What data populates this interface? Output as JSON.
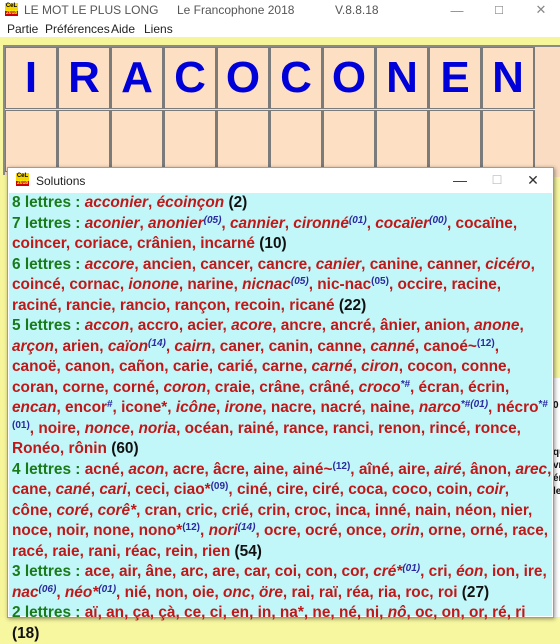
{
  "window": {
    "title": "LE MOT LE PLUS LONG",
    "subtitle": "Le Francophone 2018",
    "version": "V.8.8.18",
    "icon": "cel-2018-logo-icon",
    "minimize": "—",
    "maximize": "☐",
    "close": "✕"
  },
  "menu": [
    "Partie",
    "Préférences",
    "Aide",
    "Liens"
  ],
  "board": {
    "letters": [
      "I",
      "R",
      "A",
      "C",
      "O",
      "C",
      "O",
      "N",
      "E",
      "N"
    ],
    "answer_slots": [
      "",
      "",
      "",
      "",
      "",
      "",
      "",
      "",
      "",
      ""
    ]
  },
  "solutions_window": {
    "title": "Solutions",
    "icon": "cel-2018-logo-icon",
    "minimize": "—",
    "maximize": "☐",
    "close": "✕",
    "groups": [
      {
        "header": "8  lettres : ",
        "count": "(2)",
        "words": [
          {
            "t": "acconier",
            "i": true
          },
          {
            "t": "écoinçon",
            "i": true
          }
        ]
      },
      {
        "header": "7  lettres : ",
        "count": "(10)",
        "words": [
          {
            "t": "aconier",
            "i": true
          },
          {
            "t": "anonier",
            "i": true,
            "s": "(05)"
          },
          {
            "t": "cannier",
            "i": true
          },
          {
            "t": "cironné",
            "i": true,
            "s": "(01)"
          },
          {
            "t": "cocaïer",
            "i": true,
            "s": "(00)"
          },
          {
            "t": "cocaïne"
          },
          {
            "t": "coincer"
          },
          {
            "t": "coriace"
          },
          {
            "t": "crânien"
          },
          {
            "t": "incarné"
          }
        ]
      },
      {
        "header": "6  lettres : ",
        "count": "(22)",
        "words": [
          {
            "t": "accore",
            "i": true
          },
          {
            "t": "ancien"
          },
          {
            "t": "cancer"
          },
          {
            "t": "cancre"
          },
          {
            "t": "canier",
            "i": true
          },
          {
            "t": "canine"
          },
          {
            "t": "canner"
          },
          {
            "t": "cicéro",
            "i": true
          },
          {
            "t": "coincé"
          },
          {
            "t": "cornac"
          },
          {
            "t": "ionone",
            "i": true
          },
          {
            "t": "narine"
          },
          {
            "t": "nicnac",
            "i": true,
            "s": "(05)"
          },
          {
            "t": "nic-nac",
            "s": "(05)",
            "su": true
          },
          {
            "t": "occire"
          },
          {
            "t": "racine"
          },
          {
            "t": "raciné"
          },
          {
            "t": "rancie"
          },
          {
            "t": "rancio"
          },
          {
            "t": "rançon"
          },
          {
            "t": "recoin"
          },
          {
            "t": "ricané"
          }
        ]
      },
      {
        "header": "5  lettres : ",
        "count": "(60)",
        "words": [
          {
            "t": "accon",
            "i": true
          },
          {
            "t": "accro"
          },
          {
            "t": "acier"
          },
          {
            "t": "acore",
            "i": true
          },
          {
            "t": "ancre"
          },
          {
            "t": "ancré"
          },
          {
            "t": "ânier"
          },
          {
            "t": "anion"
          },
          {
            "t": "anone",
            "i": true
          },
          {
            "t": "arçon",
            "i": true
          },
          {
            "t": "arien"
          },
          {
            "t": "caïon",
            "i": true,
            "s": "(14)"
          },
          {
            "t": "cairn",
            "i": true
          },
          {
            "t": "caner"
          },
          {
            "t": "canin"
          },
          {
            "t": "canne"
          },
          {
            "t": "canné",
            "i": true
          },
          {
            "t": "canoé~",
            "s": "(12)",
            "su": true
          },
          {
            "t": "canoë"
          },
          {
            "t": "canon"
          },
          {
            "t": "cañon"
          },
          {
            "t": "carie"
          },
          {
            "t": "carié"
          },
          {
            "t": "carne"
          },
          {
            "t": "carné",
            "i": true
          },
          {
            "t": "ciron",
            "i": true
          },
          {
            "t": "cocon"
          },
          {
            "t": "conne"
          },
          {
            "t": "coran"
          },
          {
            "t": "corne"
          },
          {
            "t": "corné"
          },
          {
            "t": "coron",
            "i": true
          },
          {
            "t": "craie"
          },
          {
            "t": "crâne"
          },
          {
            "t": "crâné"
          },
          {
            "t": "croco",
            "i": true,
            "s": "*#"
          },
          {
            "t": "écran"
          },
          {
            "t": "écrin"
          },
          {
            "t": "encan",
            "i": true
          },
          {
            "t": "encor",
            "s": "#",
            "su": true
          },
          {
            "t": "icone*"
          },
          {
            "t": "icône",
            "i": true
          },
          {
            "t": "irone",
            "i": true
          },
          {
            "t": "nacre"
          },
          {
            "t": "nacré"
          },
          {
            "t": "naine"
          },
          {
            "t": "narco",
            "i": true,
            "s": "*#(01)"
          },
          {
            "t": "nécro",
            "s": "*#(01)",
            "su": true
          },
          {
            "t": "noire"
          },
          {
            "t": "nonce",
            "i": true
          },
          {
            "t": "noria",
            "i": true
          },
          {
            "t": "océan"
          },
          {
            "t": "rainé"
          },
          {
            "t": "rance"
          },
          {
            "t": "ranci"
          },
          {
            "t": "renon"
          },
          {
            "t": "rincé"
          },
          {
            "t": "ronce"
          },
          {
            "t": "Ronéo"
          },
          {
            "t": "rônin"
          }
        ]
      },
      {
        "header": "4  lettres : ",
        "count": "(54)",
        "words": [
          {
            "t": "acné"
          },
          {
            "t": "acon",
            "i": true
          },
          {
            "t": "acre"
          },
          {
            "t": "âcre"
          },
          {
            "t": "aine"
          },
          {
            "t": "ainé~",
            "s": "(12)",
            "su": true
          },
          {
            "t": "aîné"
          },
          {
            "t": "aire"
          },
          {
            "t": "airé",
            "i": true
          },
          {
            "t": "ânon"
          },
          {
            "t": "arec",
            "i": true
          },
          {
            "t": "cane"
          },
          {
            "t": "cané",
            "i": true
          },
          {
            "t": "cari",
            "i": true
          },
          {
            "t": "ceci"
          },
          {
            "t": "ciao*",
            "s": "(09)",
            "su": true
          },
          {
            "t": "ciné"
          },
          {
            "t": "cire"
          },
          {
            "t": "ciré"
          },
          {
            "t": "coca"
          },
          {
            "t": "coco"
          },
          {
            "t": "coin"
          },
          {
            "t": "coir",
            "i": true
          },
          {
            "t": "cône"
          },
          {
            "t": "coré",
            "i": true
          },
          {
            "t": "corê*",
            "i": true
          },
          {
            "t": "cran"
          },
          {
            "t": "cric"
          },
          {
            "t": "crié"
          },
          {
            "t": "crin"
          },
          {
            "t": "croc"
          },
          {
            "t": "inca"
          },
          {
            "t": "inné"
          },
          {
            "t": "nain"
          },
          {
            "t": "néon"
          },
          {
            "t": "nier"
          },
          {
            "t": "noce"
          },
          {
            "t": "noir"
          },
          {
            "t": "none"
          },
          {
            "t": "nono*",
            "s": "(12)",
            "su": true
          },
          {
            "t": "nori",
            "i": true,
            "s": "(14)"
          },
          {
            "t": "ocre"
          },
          {
            "t": "ocré"
          },
          {
            "t": "once"
          },
          {
            "t": "orin",
            "i": true
          },
          {
            "t": "orne"
          },
          {
            "t": "orné"
          },
          {
            "t": "race"
          },
          {
            "t": "racé"
          },
          {
            "t": "raie"
          },
          {
            "t": "rani"
          },
          {
            "t": "réac"
          },
          {
            "t": "rein"
          },
          {
            "t": "rien"
          }
        ]
      },
      {
        "header": "3  lettres : ",
        "count": "(27)",
        "words": [
          {
            "t": "ace"
          },
          {
            "t": "air"
          },
          {
            "t": "âne"
          },
          {
            "t": "arc"
          },
          {
            "t": "are"
          },
          {
            "t": "car"
          },
          {
            "t": "coi"
          },
          {
            "t": "con"
          },
          {
            "t": "cor"
          },
          {
            "t": "cré*",
            "i": true,
            "s": "(01)"
          },
          {
            "t": "cri"
          },
          {
            "t": "éon",
            "i": true
          },
          {
            "t": "ion"
          },
          {
            "t": "ire"
          },
          {
            "t": "nac",
            "i": true,
            "s": "(06)"
          },
          {
            "t": "néo*",
            "i": true,
            "s": "(01)"
          },
          {
            "t": "nié"
          },
          {
            "t": "non"
          },
          {
            "t": "oie"
          },
          {
            "t": "onc",
            "i": true
          },
          {
            "t": "öre",
            "i": true
          },
          {
            "t": "rai"
          },
          {
            "t": "raï"
          },
          {
            "t": "réa"
          },
          {
            "t": "ria"
          },
          {
            "t": "roc"
          },
          {
            "t": "roi"
          }
        ]
      },
      {
        "header": "2  lettres : ",
        "count": "(18)",
        "words": [
          {
            "t": "aï"
          },
          {
            "t": "an"
          },
          {
            "t": "ça"
          },
          {
            "t": "çà"
          },
          {
            "t": "ce"
          },
          {
            "t": "ci"
          },
          {
            "t": "en"
          },
          {
            "t": "in"
          },
          {
            "t": "na*"
          },
          {
            "t": "ne"
          },
          {
            "t": "né"
          },
          {
            "t": "ni"
          },
          {
            "t": "nô",
            "i": true
          },
          {
            "t": "oc"
          },
          {
            "t": "on"
          },
          {
            "t": "or"
          },
          {
            "t": "ré"
          },
          {
            "t": "ri"
          }
        ]
      }
    ]
  },
  "background_partial_text": [
    "0",
    "qu",
    "vr",
    "ér",
    "le"
  ]
}
